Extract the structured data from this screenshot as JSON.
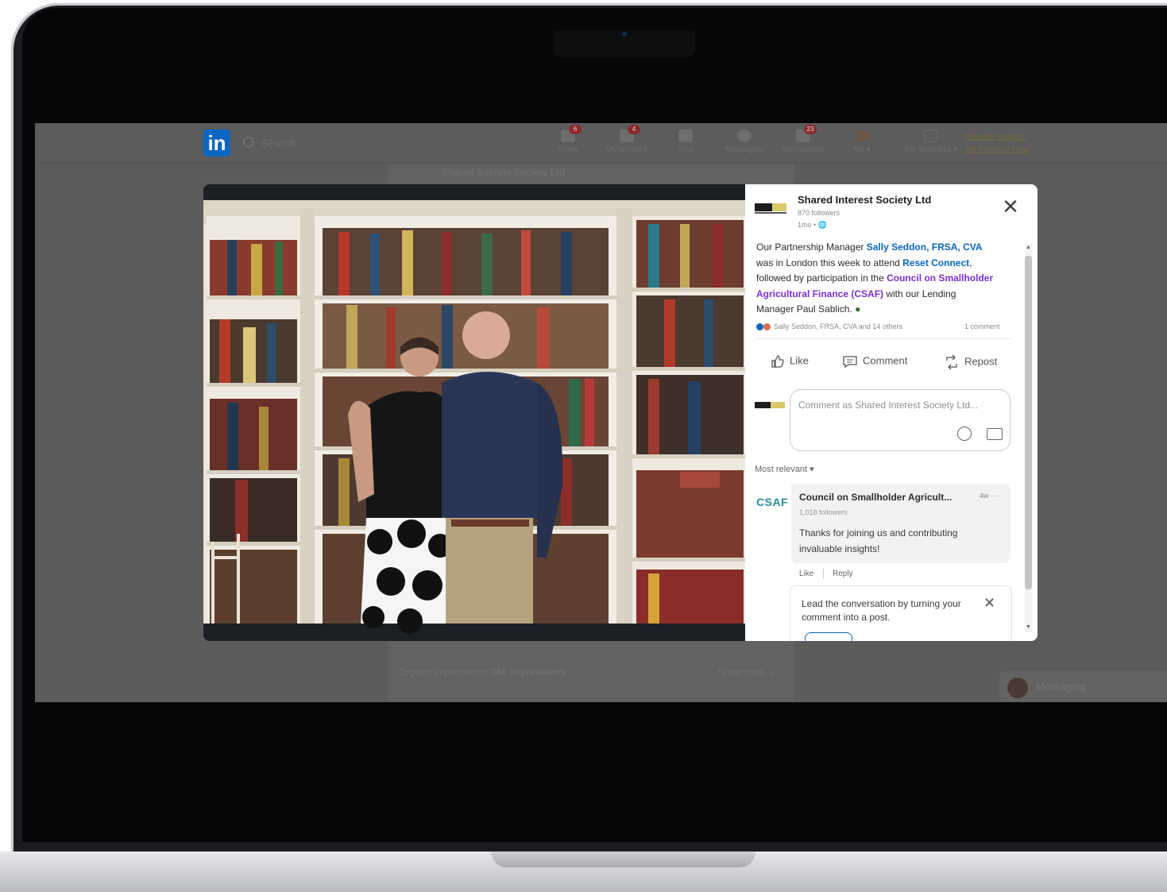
{
  "linkedin": {
    "logo": "in",
    "search_placeholder": "Search",
    "nav": [
      {
        "label": "Home",
        "badge": "6"
      },
      {
        "label": "My Network",
        "badge": "4"
      },
      {
        "label": "Jobs",
        "badge": ""
      },
      {
        "label": "Messaging",
        "badge": ""
      },
      {
        "label": "Notifications",
        "badge": "23"
      },
      {
        "label": "Me ▾",
        "badge": ""
      },
      {
        "label": "For Business ▾",
        "badge": ""
      }
    ],
    "premium_line1": "Network Smarter,",
    "premium_line2": "Try Premium Free"
  },
  "background": {
    "post_title": "Shared Interest Society Ltd",
    "impressions_label": "Organic impressions:",
    "impressions_value": "360 impressions",
    "show_stats": "Show stats",
    "messaging": "Messaging",
    "messaging_more": "···"
  },
  "modal": {
    "company": "Shared Interest Society Ltd",
    "followers": "870 followers",
    "time": "1mo •",
    "post_text": {
      "t1": "Our Partnership Manager ",
      "m1": "Sally Seddon, FRSA, CVA",
      "t2": " was in London this week to attend ",
      "m2": "Reset Connect",
      "t3": ", followed by participation in the ",
      "m3": "Council on Smallholder Agricultural Finance (CSAF)",
      "t4": " with our Lending Manager Paul Sablich. "
    },
    "reactions_text": "Sally Seddon, FRSA, CVA and 14 others",
    "comments_count": "1 comment",
    "actions": {
      "like": "Like",
      "comment": "Comment",
      "repost": "Repost"
    },
    "comment_placeholder": "Comment as Shared Interest Society Ltd...",
    "sort": "Most relevant ▾",
    "comment": {
      "logo": "CSAF",
      "author": "Council on Smallholder Agricult...",
      "time": "4w",
      "more": "···",
      "followers": "1,018 followers",
      "text": "Thanks for joining us and contributing invaluable insights!",
      "like": "Like",
      "reply": "Reply"
    },
    "tip": "Lead the conversation by turning your comment into a post.",
    "close": "✕"
  },
  "colors": {
    "linkedin_blue": "#0a66c2",
    "mention_purple": "#7a2fd1",
    "csaf_teal": "#2b8a9c"
  }
}
